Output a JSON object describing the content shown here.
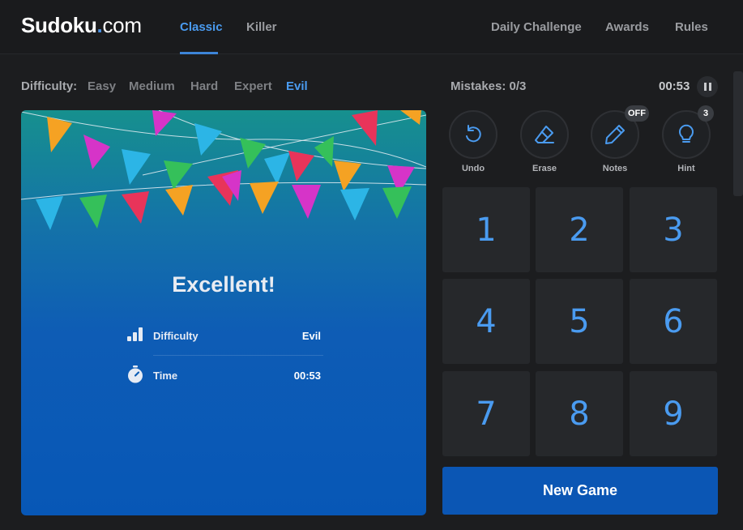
{
  "header": {
    "logo_main": "Sudoku",
    "logo_dot": ".",
    "logo_tld": "com",
    "tabs": [
      {
        "label": "Classic",
        "active": true
      },
      {
        "label": "Killer",
        "active": false
      }
    ],
    "links": [
      "Daily Challenge",
      "Awards",
      "Rules"
    ]
  },
  "difficulty": {
    "label": "Difficulty:",
    "levels": [
      "Easy",
      "Medium",
      "Hard",
      "Expert",
      "Evil"
    ],
    "selected": "Evil"
  },
  "status": {
    "mistakes": "Mistakes: 0/3",
    "timer": "00:53",
    "pause_icon": "pause-icon"
  },
  "win_panel": {
    "title": "Excellent!",
    "stats": [
      {
        "label": "Difficulty",
        "value": "Evil",
        "icon": "signal-bars-icon"
      },
      {
        "label": "Time",
        "value": "00:53",
        "icon": "stopwatch-icon"
      }
    ]
  },
  "tools": [
    {
      "label": "Undo",
      "icon": "undo-icon"
    },
    {
      "label": "Erase",
      "icon": "eraser-icon"
    },
    {
      "label": "Notes",
      "icon": "pencil-icon",
      "badge": "OFF"
    },
    {
      "label": "Hint",
      "icon": "lightbulb-icon",
      "badge": "3"
    }
  ],
  "numpad": [
    "1",
    "2",
    "3",
    "4",
    "5",
    "6",
    "7",
    "8",
    "9"
  ],
  "new_game_label": "New Game",
  "colors": {
    "accent": "#4a9bf0",
    "background": "#1c1d1f",
    "key_background": "#26282b",
    "button_blue": "#0b56b4"
  }
}
